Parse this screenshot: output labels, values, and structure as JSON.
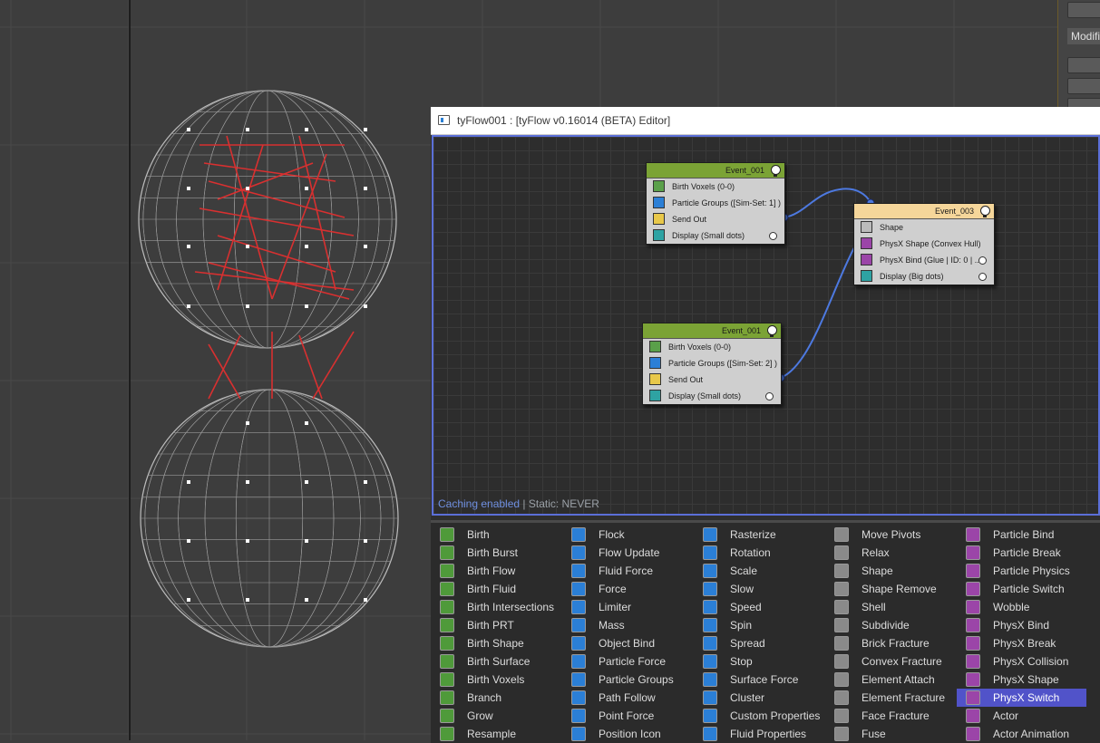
{
  "right_panel": {
    "modifier_label": "Modifie"
  },
  "editor": {
    "title": "tyFlow001 : [tyFlow v0.16014 (BETA) Editor]",
    "status_caching": "Caching enabled",
    "status_sep": " | ",
    "status_static": "Static: NEVER",
    "events": [
      {
        "name": "Event_001",
        "operators": [
          {
            "label": "Birth Voxels (0-0)",
            "icon": "birth-voxels-icon"
          },
          {
            "label": "Particle Groups ([Sim-Set: 1] )",
            "icon": "particle-groups-icon"
          },
          {
            "label": "Send Out",
            "icon": "send-out-icon"
          },
          {
            "label": "Display (Small dots)",
            "icon": "display-icon"
          }
        ]
      },
      {
        "name": "Event_003",
        "operators": [
          {
            "label": "Shape",
            "icon": "shape-icon"
          },
          {
            "label": "PhysX Shape (Convex Hull)",
            "icon": "physx-shape-icon"
          },
          {
            "label": "PhysX Bind (Glue | ID: 0 | ...",
            "icon": "physx-bind-icon"
          },
          {
            "label": "Display (Big dots)",
            "icon": "display-icon"
          }
        ]
      },
      {
        "name": "Event_001",
        "operators": [
          {
            "label": "Birth Voxels (0-0)",
            "icon": "birth-voxels-icon"
          },
          {
            "label": "Particle Groups ([Sim-Set: 2] )",
            "icon": "particle-groups-icon"
          },
          {
            "label": "Send Out",
            "icon": "send-out-icon"
          },
          {
            "label": "Display (Small dots)",
            "icon": "display-icon"
          }
        ]
      }
    ]
  },
  "colors": {
    "birth_event_header": "#7ba335",
    "physx_event_header": "#f5d69a",
    "selection": "#5153c9",
    "canvas_border": "#5b6fd8",
    "wire": "#4d79e0",
    "sphere_red": "#d83030"
  },
  "operator_list": {
    "selected": "PhysX Switch",
    "columns": [
      [
        "Birth",
        "Birth Burst",
        "Birth Flow",
        "Birth Fluid",
        "Birth Intersections",
        "Birth PRT",
        "Birth Shape",
        "Birth Surface",
        "Birth Voxels",
        "Branch",
        "Grow",
        "Resample"
      ],
      [
        "Flock",
        "Flow Update",
        "Fluid Force",
        "Force",
        "Limiter",
        "Mass",
        "Object Bind",
        "Particle Force",
        "Particle Groups",
        "Path Follow",
        "Point Force",
        "Position Icon"
      ],
      [
        "Rasterize",
        "Rotation",
        "Scale",
        "Slow",
        "Speed",
        "Spin",
        "Spread",
        "Stop",
        "Surface Force",
        "Cluster",
        "Custom Properties",
        "Fluid Properties"
      ],
      [
        "Move Pivots",
        "Relax",
        "Shape",
        "Shape Remove",
        "Shell",
        "Subdivide",
        "Brick Fracture",
        "Convex Fracture",
        "Element Attach",
        "Element Fracture",
        "Face Fracture",
        "Fuse"
      ],
      [
        "Particle Bind",
        "Particle Break",
        "Particle Physics",
        "Particle Switch",
        "Wobble",
        "PhysX Bind",
        "PhysX Break",
        "PhysX Collision",
        "PhysX Shape",
        "PhysX Switch",
        "Actor",
        "Actor Animation"
      ]
    ],
    "icon_colors": [
      "#4f9a3a",
      "#2b7fd6",
      "#2b7fd6",
      "#8a8a8a",
      "#9b45a8"
    ]
  }
}
